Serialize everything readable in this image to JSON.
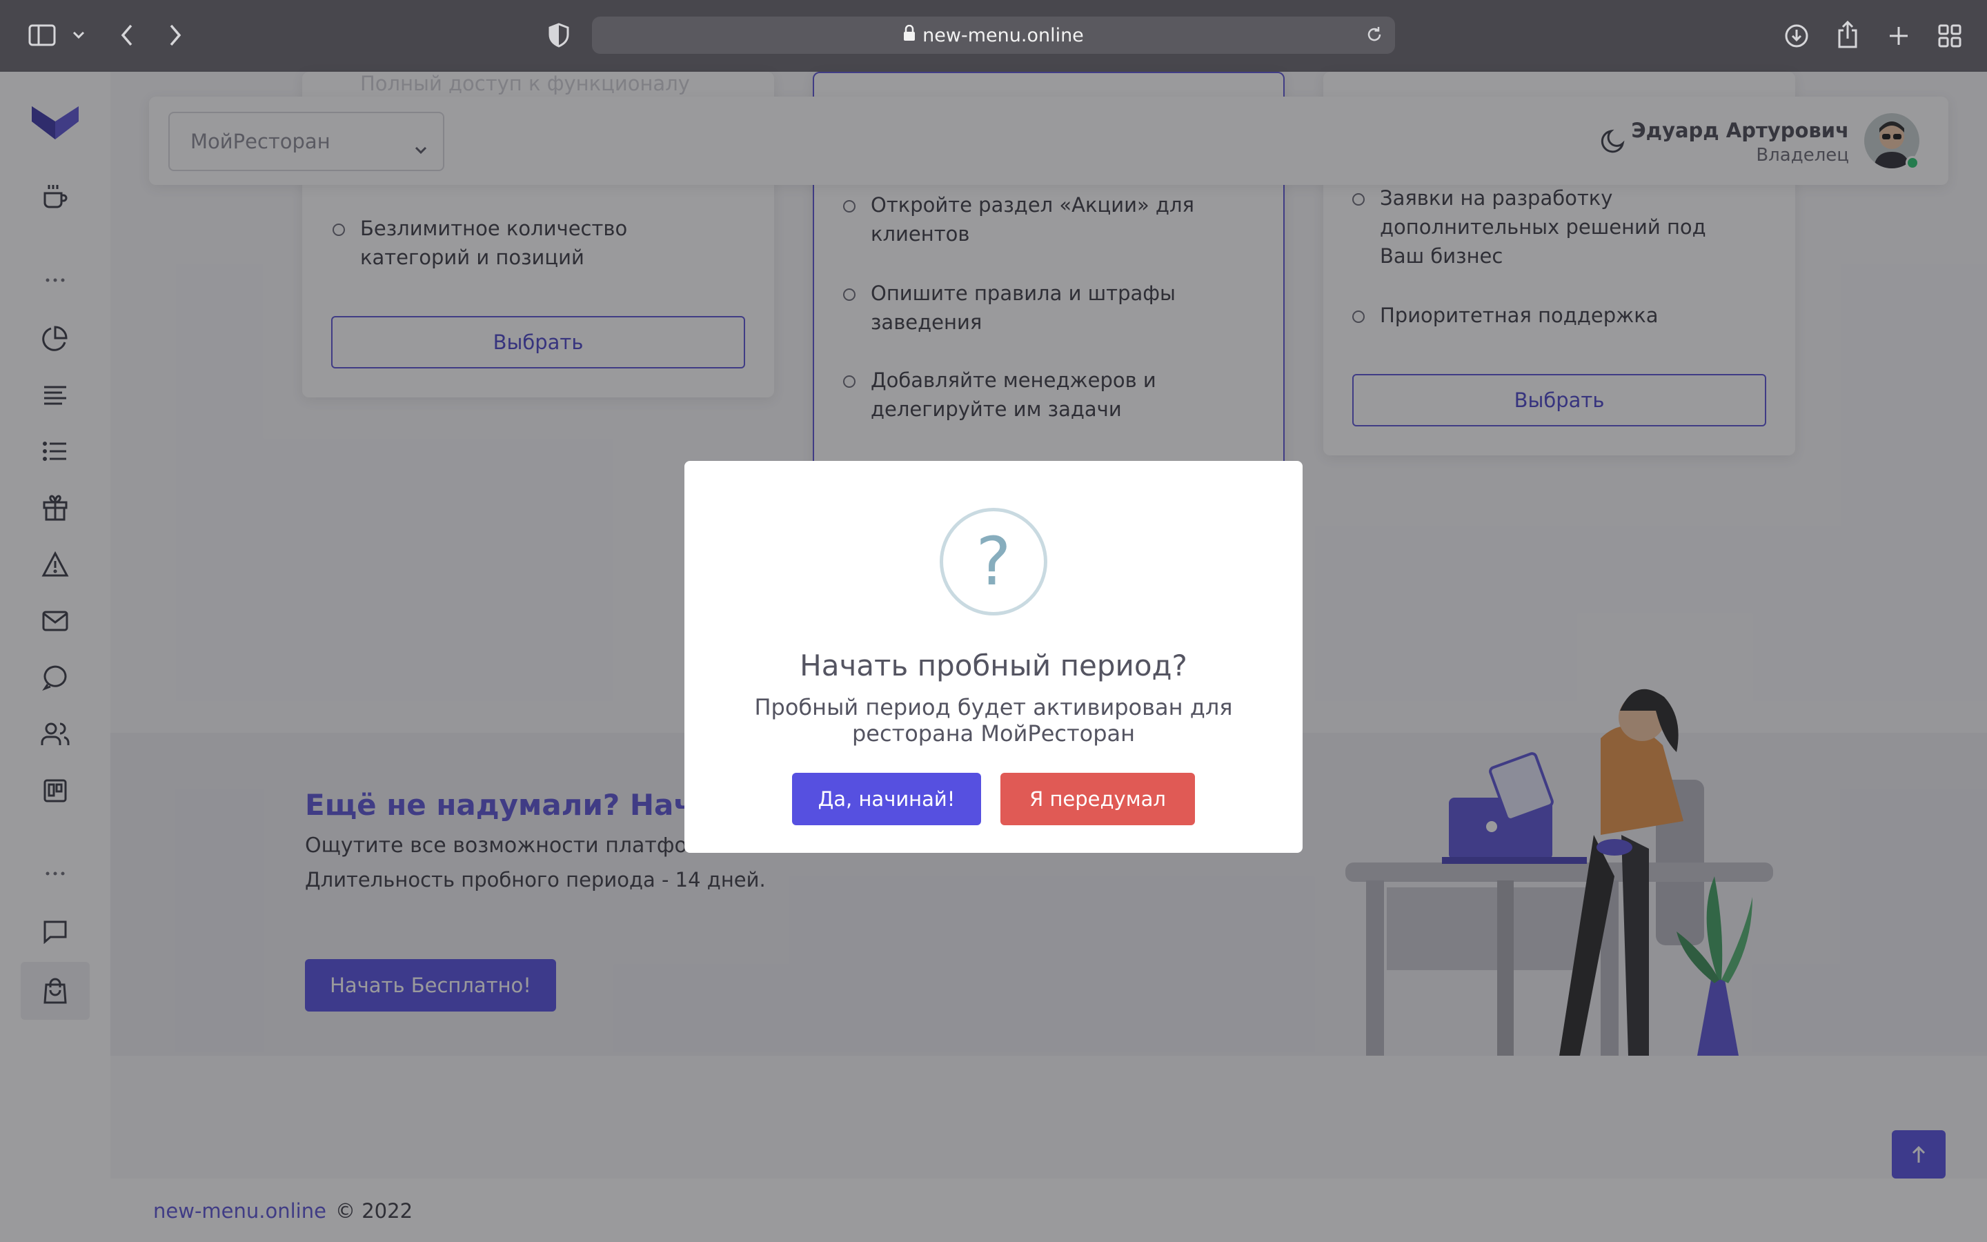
{
  "browser": {
    "url": "new-menu.online",
    "icons": [
      "sidebar-toggle-icon",
      "chevron-down-icon",
      "back-arrow-icon",
      "forward-arrow-icon",
      "shield-icon",
      "lock-icon",
      "reload-icon",
      "download-icon",
      "share-icon",
      "new-tab-plus-icon",
      "tab-grid-icon"
    ]
  },
  "sidebar": {
    "icons": [
      "logo",
      "coffee-cup-icon",
      "more-dots-icon",
      "pie-chart-icon",
      "align-left-icon",
      "list-icon",
      "gift-icon",
      "warning-triangle-icon",
      "mail-icon",
      "message-circle-icon",
      "users-icon",
      "board-icon",
      "more-dots-icon",
      "chat-square-icon",
      "shopping-bag-icon"
    ]
  },
  "header": {
    "restaurant_select": "МойРесторан",
    "user_name": "Эдуард Артурович",
    "user_role": "Владелец",
    "status_color": "#28c76f"
  },
  "plans": {
    "card1": {
      "faded_text": "Полный доступ к функционалу",
      "features": [
        "Безлимитное количество категорий и позиций"
      ],
      "button": "Выбрать"
    },
    "card2": {
      "features": [
        "Откройте раздел «Акции» для клиентов",
        "Опишите правила и штрафы заведения",
        "Добавляйте менеджеров и делегируйте им задачи"
      ]
    },
    "card3": {
      "features": [
        "Заявки на разработку дополнительных решений под Ваш бизнес",
        "Приоритетная поддержка"
      ],
      "button": "Выбрать"
    }
  },
  "promo": {
    "title": "Ещё не надумали? Начн",
    "line1": "Ощутите все возможности платфо",
    "line2": "Длительность пробного периода - 14 дней.",
    "button": "Начать Бесплатно!"
  },
  "modal": {
    "icon": "?",
    "title": "Начать пробный период?",
    "text": "Пробный период будет активирован для ресторана МойРесторан",
    "confirm": "Да, начинай!",
    "cancel": "Я передумал",
    "confirm_color": "#5650e0",
    "cancel_color": "#e05a55"
  },
  "footer": {
    "link": "new-menu.online",
    "copy": "© 2022"
  },
  "colors": {
    "accent": "#5b55d6",
    "chrome": "#48474d"
  }
}
